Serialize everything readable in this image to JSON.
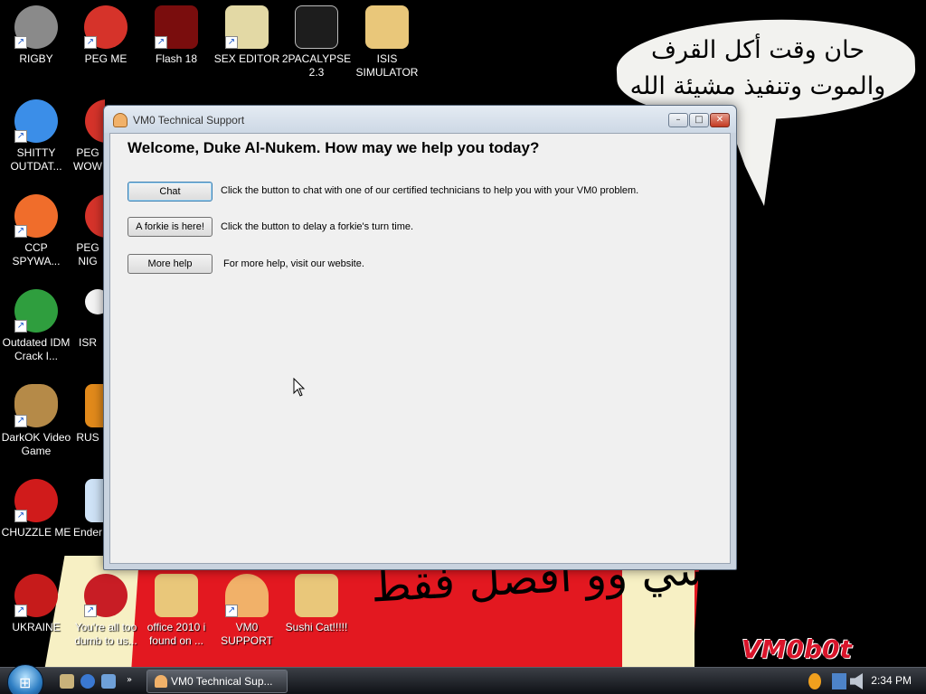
{
  "wallpaper": {
    "bubble_line1": "حان وقت أكل القرف",
    "bubble_line2": "والموت وتنفيذ مشيئة الله",
    "flag_text": "مارسي وو افصل فقط",
    "watermark": "VM0b0t"
  },
  "desktop_icons": [
    {
      "label": "RIGBY",
      "icon": "raccoon-icon",
      "color": "#8a8a8a"
    },
    {
      "label": "PEG ME",
      "icon": "peg-icon",
      "color": "#d6332a"
    },
    {
      "label": "Flash 18",
      "icon": "flash-icon",
      "color": "#7a0d0d"
    },
    {
      "label": "SEX EDITOR",
      "icon": "hxd-icon",
      "color": "#e3d9a5"
    },
    {
      "label": "2PACALYPSE 2.3",
      "icon": "terminal-icon",
      "color": "#1d1d1d"
    },
    {
      "label": "ISIS SIMULATOR",
      "icon": "folder-icon",
      "color": "#e9c77a"
    },
    {
      "label": "SHITTY OUTDAT...",
      "icon": "chrome-icon",
      "color": "#3b8ee8"
    },
    {
      "label": "PEG WOW",
      "icon": "peg-icon",
      "color": "#d6332a"
    },
    {
      "label": "CCP SPYWA...",
      "icon": "pinwheel-icon",
      "color": "#f06d2b"
    },
    {
      "label": "PEG NIG",
      "icon": "peg-icon",
      "color": "#d6332a"
    },
    {
      "label": "Outdated IDM Crack I...",
      "icon": "download-globe-icon",
      "color": "#2f9e3e"
    },
    {
      "label": "ISR",
      "icon": "flower-icon",
      "color": "#f4f4f4"
    },
    {
      "label": "DarkOK Video Game",
      "icon": "money-bag-icon",
      "color": "#b58a48"
    },
    {
      "label": "RUS",
      "icon": "box-icon",
      "color": "#e28a1b"
    },
    {
      "label": "CHUZZLE ME",
      "icon": "chuzzle-icon",
      "color": "#d01b1b"
    },
    {
      "label": "Ender",
      "icon": "window-icon",
      "color": "#cfe3f7"
    },
    {
      "label": "UKRAINE",
      "icon": "radiation-icon",
      "color": "#c61b1b"
    },
    {
      "label": "You're all too dumb to us...",
      "icon": "devcpp-icon",
      "color": "#c81d25"
    },
    {
      "label": "office 2010 i found on ...",
      "icon": "folder-icon",
      "color": "#e9c77a"
    },
    {
      "label": "VM0 SUPPORT",
      "icon": "doctor-icon",
      "color": "#f1b169"
    },
    {
      "label": "Sushi Cat!!!!!",
      "icon": "folder-icon",
      "color": "#e9c77a"
    }
  ],
  "window": {
    "title": "VM0 Technical Support",
    "minimize": "–",
    "maximize": "□",
    "close": "✕",
    "welcome": "Welcome, Duke Al-Nukem. How may we help you today?",
    "rows": [
      {
        "button": "Chat",
        "desc": "Click the button to chat with one of our certified technicians to help you with your VM0 problem."
      },
      {
        "button": "A forkie is here!",
        "desc": "Click the button to delay a forkie's turn time."
      },
      {
        "button": "More help",
        "desc": "For more help, visit our website."
      }
    ]
  },
  "taskbar": {
    "start_glyph": "⊞",
    "task_label": "VM0 Technical Sup...",
    "clock": "2:34 PM"
  },
  "colors": {
    "window_bg": "#f0f0f0",
    "taskbar": "#1b1e24",
    "flag_red": "#e31820",
    "watermark": "#d9142a"
  }
}
